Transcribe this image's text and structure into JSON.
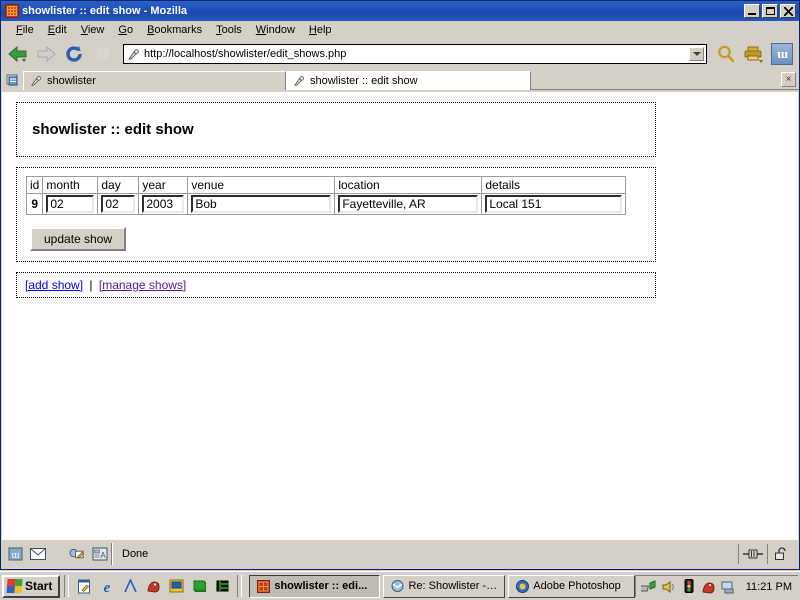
{
  "window": {
    "title": "showlister :: edit show - Mozilla",
    "icon": "mozilla-dino-icon",
    "controls": {
      "minimize": "_",
      "maximize": "□",
      "close": "×"
    }
  },
  "menubar": {
    "items": [
      {
        "label": "File",
        "accel": "F"
      },
      {
        "label": "Edit",
        "accel": "E"
      },
      {
        "label": "View",
        "accel": "V"
      },
      {
        "label": "Go",
        "accel": "G"
      },
      {
        "label": "Bookmarks",
        "accel": "B"
      },
      {
        "label": "Tools",
        "accel": "T"
      },
      {
        "label": "Window",
        "accel": "W"
      },
      {
        "label": "Help",
        "accel": "H"
      }
    ]
  },
  "toolbar": {
    "back": "back-arrow-icon",
    "forward": "forward-arrow-icon",
    "reload": "reload-icon",
    "stop": "stop-icon",
    "url": "http://localhost/showlister/edit_shows.php",
    "url_icon": "page-tag-icon",
    "dropdown": "chevron-down-icon",
    "search": "search-magnifier-icon",
    "print": "print-icon",
    "logo": "mozilla-logo-icon"
  },
  "tabs": {
    "new_tab_icon": "new-tab-icon",
    "close_tab_label": "×",
    "items": [
      {
        "label": "showlister",
        "active": false
      },
      {
        "label": "showlister :: edit show",
        "active": true
      }
    ]
  },
  "page": {
    "heading": "showlister :: edit show",
    "table": {
      "headers": [
        "id",
        "month",
        "day",
        "year",
        "venue",
        "location",
        "details"
      ],
      "row": {
        "id": "9",
        "month": "02",
        "day": "02",
        "year": "2003",
        "venue": "Bob",
        "location": "Fayetteville, AR",
        "details": "Local 151"
      }
    },
    "submit_label": "update show",
    "links": [
      {
        "label": "[add show]",
        "state": "unvisited"
      },
      {
        "label": "[manage shows]",
        "state": "visited"
      }
    ],
    "link_separator": "|"
  },
  "statusbar": {
    "icons": [
      "browser-icon",
      "mail-icon",
      "composer-icon",
      "addressbook-icon"
    ],
    "status": "Done",
    "right_icons": [
      "connection-icon",
      "unlocked-padlock-icon"
    ]
  },
  "taskbar": {
    "start_label": "Start",
    "quicklaunch": [
      "notepad-icon",
      "internet-explorer-icon",
      "netscape-icon",
      "mozilla-dino-icon",
      "media-icon",
      "book-icon",
      "terminal-icon"
    ],
    "tasks": [
      {
        "label": "showlister :: edi...",
        "icon": "mozilla-dino-icon",
        "active": true
      },
      {
        "label": "Re: Showlister - I...",
        "icon": "mail-icon",
        "active": false
      },
      {
        "label": "Adobe Photoshop",
        "icon": "photoshop-icon",
        "active": false
      }
    ],
    "tray": [
      "network-icon",
      "volume-icon",
      "traffic-light-icon",
      "dino-tray-icon",
      "display-icon"
    ],
    "clock": "11:21 PM"
  },
  "colors": {
    "titlebar": "#1d4fb8",
    "chrome": "#d4d0c8",
    "link_unvisited": "#0000ee",
    "link_visited": "#551a8b",
    "page_background": "#ffffff"
  }
}
